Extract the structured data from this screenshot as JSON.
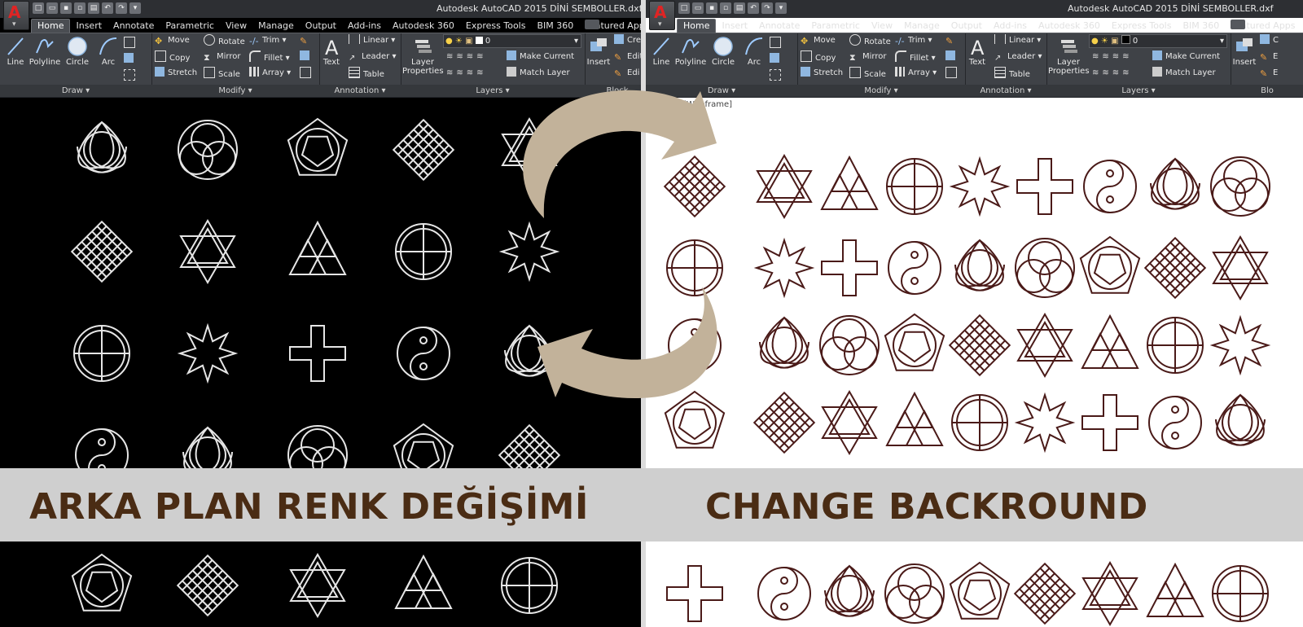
{
  "window": {
    "left_title": "Autodesk AutoCAD 2015    DİNİ SEMBOLLER.dxf",
    "right_title": "Autodesk AutoCAD 2015    DİNİ SEMBOLLER.dxf"
  },
  "tabs": [
    "Home",
    "Insert",
    "Annotate",
    "Parametric",
    "View",
    "Manage",
    "Output",
    "Add-ins",
    "Autodesk 360",
    "Express Tools",
    "BIM 360",
    "Featured Apps"
  ],
  "ribbon": {
    "draw": {
      "line": "Line",
      "polyline": "Polyline",
      "circle": "Circle",
      "arc": "Arc",
      "title": "Draw ▾"
    },
    "modify": {
      "move": "Move",
      "copy": "Copy",
      "stretch": "Stretch",
      "rotate": "Rotate",
      "mirror": "Mirror",
      "scale": "Scale",
      "trim": "Trim ▾",
      "fillet": "Fillet ▾",
      "array": "Array ▾",
      "title": "Modify ▾"
    },
    "annotation": {
      "text": "Text",
      "linear": "Linear ▾",
      "leader": "Leader ▾",
      "table": "Table",
      "title": "Annotation ▾"
    },
    "layers": {
      "properties_line1": "Layer",
      "properties_line2": "Properties",
      "layer_value": "0",
      "make_current": "Make Current",
      "match_layer": "Match Layer",
      "title": "Layers ▾"
    },
    "block": {
      "insert": "Insert",
      "create": "Cre",
      "edit": "Edit",
      "edit2": "Edi",
      "title": "Block",
      "create_r": "C",
      "edit_r": "E",
      "edit2_r": "E",
      "title_r": "Blo"
    }
  },
  "viewport_label": "[-][Top][Wireframe]",
  "banner": {
    "left": "ARKA PLAN RENK DEĞİŞİMİ",
    "right": "CHANGE BACKROUND"
  },
  "colors": {
    "banner_bg": "#cfcfcf",
    "banner_text": "#4a2c14",
    "arrow": "#c2b29a",
    "left_symbol": "#e6e6e6",
    "right_symbol": "#4a1a18"
  },
  "icons": {
    "app_button": "autocad-logo-icon",
    "arrows": "swap-arrows-icon"
  }
}
